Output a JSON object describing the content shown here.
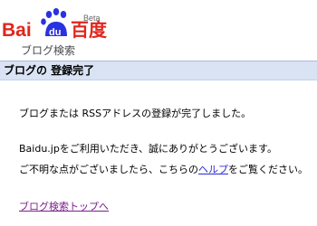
{
  "logo": {
    "brand_left": "Bai",
    "brand_mid": "du",
    "brand_right": "百度",
    "beta": "Beta",
    "subtitle": "ブログ検索",
    "colors": {
      "red": "#e1251b",
      "blue": "#2932e1"
    }
  },
  "page_title": "ブログの 登録完了",
  "content": {
    "message1": "ブログまたは RSSアドレスの登録が完了しました。",
    "message2": "Baidu.jpをご利用いただき、誠にありがとうございます。",
    "message3_before": "ご不明な点がございましたら、こちらの",
    "help_link": "ヘルプ",
    "message3_after": "をご覧ください。",
    "top_link": "ブログ検索トップへ"
  }
}
